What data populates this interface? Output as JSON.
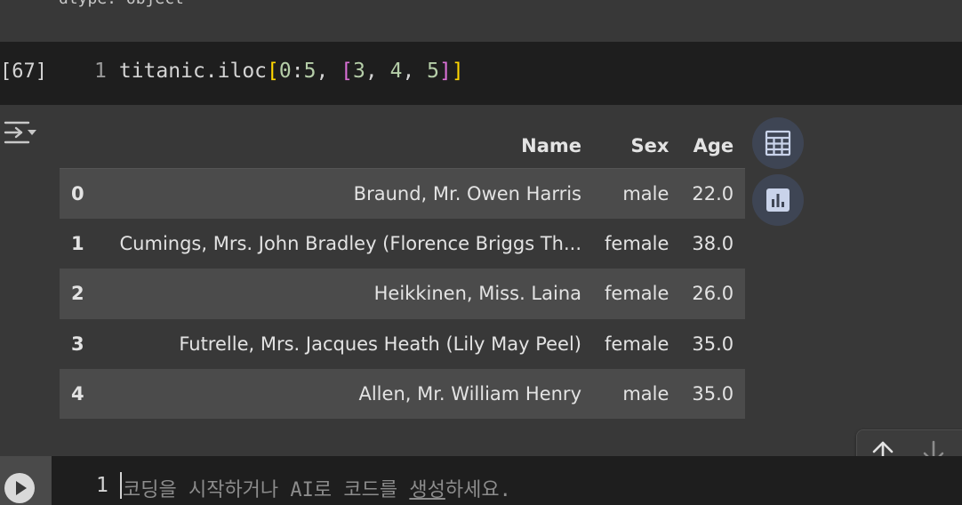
{
  "previous_output": {
    "text": "dtype: object"
  },
  "code_cell": {
    "execution_count": "[67]",
    "line_number": "1",
    "code": {
      "object": "titanic.iloc",
      "open_bracket": "[",
      "row_start": "0",
      "colon": ":",
      "row_end": "5",
      "comma1": ", ",
      "list_open": "[",
      "col1": "3",
      "comma2": ", ",
      "col2": "4",
      "comma3": ", ",
      "col3": "5",
      "list_close": "]",
      "close_bracket": "]"
    }
  },
  "output": {
    "toggle_icon": "output-collapse-icon",
    "table": {
      "columns": [
        "Name",
        "Sex",
        "Age"
      ],
      "rows": [
        {
          "index": "0",
          "Name": "Braund, Mr. Owen Harris",
          "Sex": "male",
          "Age": "22.0"
        },
        {
          "index": "1",
          "Name": "Cumings, Mrs. John Bradley (Florence Briggs Th...",
          "Sex": "female",
          "Age": "38.0"
        },
        {
          "index": "2",
          "Name": "Heikkinen, Miss. Laina",
          "Sex": "female",
          "Age": "26.0"
        },
        {
          "index": "3",
          "Name": "Futrelle, Mrs. Jacques Heath (Lily May Peel)",
          "Sex": "female",
          "Age": "35.0"
        },
        {
          "index": "4",
          "Name": "Allen, Mr. William Henry",
          "Sex": "male",
          "Age": "35.0"
        }
      ]
    },
    "side_buttons": [
      {
        "icon": "table-icon"
      },
      {
        "icon": "bar-chart-icon"
      }
    ]
  },
  "cell_nav": {
    "up_icon": "arrow-up-icon",
    "down_icon": "arrow-down-icon"
  },
  "new_cell": {
    "line_number": "1",
    "placeholder_start": "코딩을 시작하거나 AI로 코드를 ",
    "placeholder_link": "생성",
    "placeholder_end": "하세요."
  },
  "colors": {
    "page_bg": "#383838",
    "editor_bg": "#1e1e1e",
    "row_stripe": "#4b4b4b",
    "bracket_yellow": "#ffd700",
    "bracket_purple": "#da70d6",
    "number_green": "#b5cea8",
    "button_bg": "#3e4554"
  }
}
